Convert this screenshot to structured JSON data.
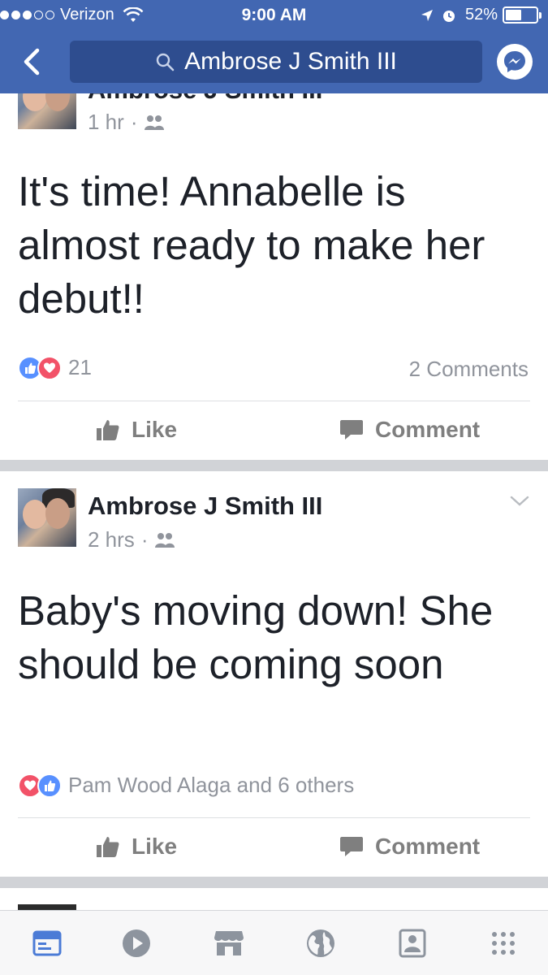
{
  "status_bar": {
    "carrier": "Verizon",
    "time": "9:00 AM",
    "battery_percent": "52%",
    "battery_level": 0.52,
    "signal_bars_filled": 3,
    "signal_bars_total": 5
  },
  "nav": {
    "search_text": "Ambrose J Smith III",
    "back_icon": "chevron-left-icon",
    "messenger_icon": "messenger-icon"
  },
  "posts": [
    {
      "author": "Ambrose J Smith III",
      "time": "1 hr",
      "audience_icon": "friends-icon",
      "text": "It's time! Annabelle is almost ready to make her debut!!",
      "reaction_count": "21",
      "comments": "2 Comments",
      "like_label": "Like",
      "comment_label": "Comment"
    },
    {
      "author": "Ambrose J Smith III",
      "time": "2 hrs",
      "audience_icon": "friends-icon",
      "text": "Baby's moving down! She should be coming soon",
      "reactors": "Pam Wood Alaga and 6 others",
      "like_label": "Like",
      "comment_label": "Comment"
    }
  ],
  "tabs": [
    {
      "name": "news-feed",
      "icon": "news-feed-icon",
      "active": true
    },
    {
      "name": "video",
      "icon": "play-icon",
      "active": false
    },
    {
      "name": "marketplace",
      "icon": "storefront-icon",
      "active": false
    },
    {
      "name": "notifications",
      "icon": "globe-icon",
      "active": false
    },
    {
      "name": "profile",
      "icon": "profile-icon",
      "active": false
    },
    {
      "name": "menu",
      "icon": "menu-grid-icon",
      "active": false
    }
  ],
  "colors": {
    "brand_blue": "#4267b2",
    "search_bg": "#2e4d8f",
    "text": "#1d2129",
    "meta": "#90949c",
    "like_blue": "#5890ff",
    "love_red": "#f25268",
    "tab_active": "#4b7bd6",
    "tab_inactive": "#8d949e"
  }
}
